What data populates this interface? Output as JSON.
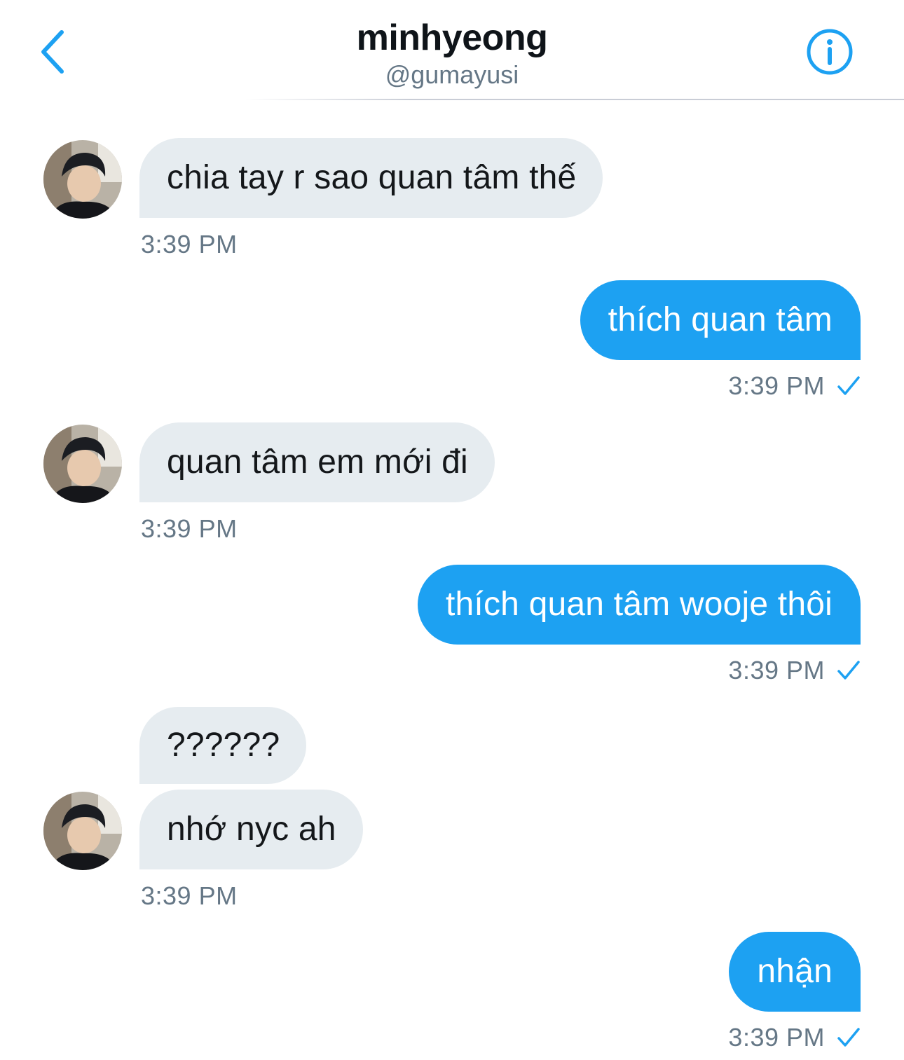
{
  "header": {
    "name": "minhyeong",
    "handle": "@gumayusi"
  },
  "messages": [
    {
      "text": "chia tay r sao quan tâm thế",
      "time": "3:39 PM"
    },
    {
      "text": "thích quan tâm",
      "time": "3:39 PM"
    },
    {
      "text": "quan tâm em mới đi",
      "time": "3:39 PM"
    },
    {
      "text": "thích quan tâm wooje thôi",
      "time": "3:39 PM"
    },
    {
      "text": "??????"
    },
    {
      "text": "nhớ nyc ah",
      "time": "3:39 PM"
    },
    {
      "text": "nhận",
      "time": "3:39 PM"
    }
  ],
  "icons": {
    "back": "chevron-left-icon",
    "info": "info-circle-icon",
    "read": "checkmark-icon"
  },
  "colors": {
    "accent": "#1da1f2",
    "incoming_bubble": "#e6ecf0",
    "meta_text": "#657786"
  }
}
